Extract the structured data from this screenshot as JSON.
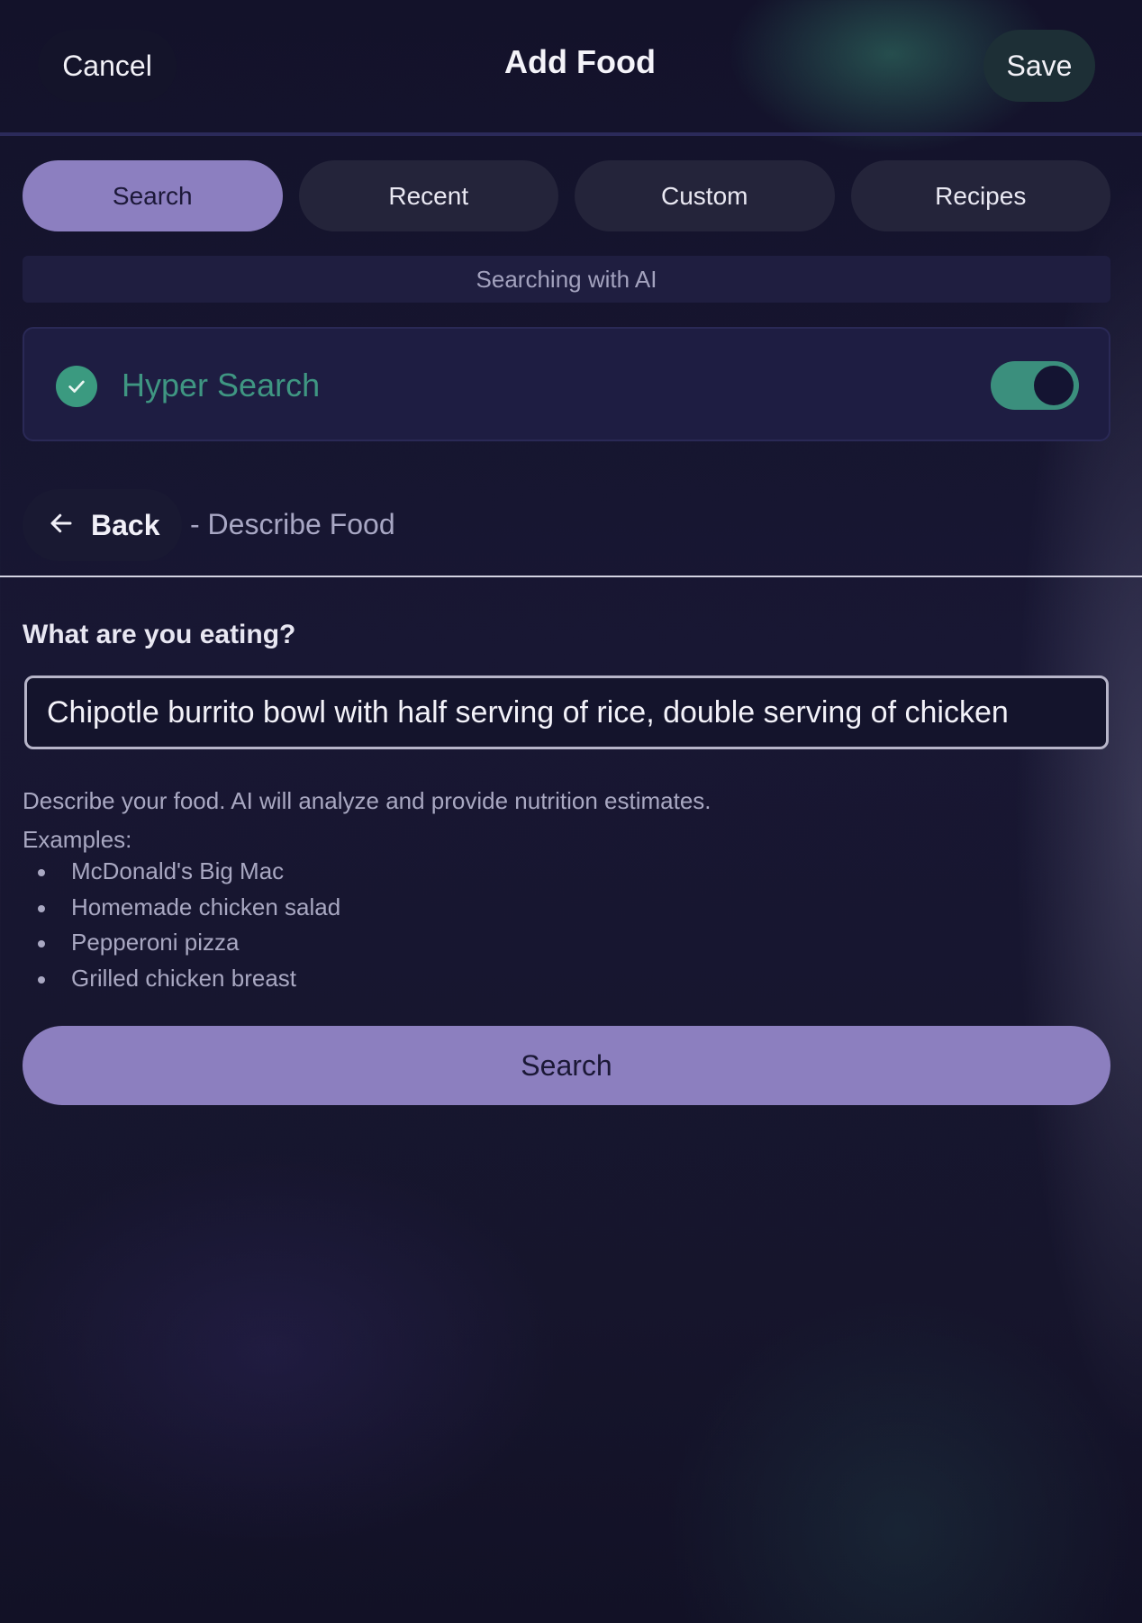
{
  "header": {
    "cancel_label": "Cancel",
    "title": "Add Food",
    "save_label": "Save"
  },
  "tabs": [
    {
      "label": "Search",
      "active": true
    },
    {
      "label": "Recent",
      "active": false
    },
    {
      "label": "Custom",
      "active": false
    },
    {
      "label": "Recipes",
      "active": false
    }
  ],
  "ai_banner": "Searching with AI",
  "hyper_search": {
    "label": "Hyper Search",
    "enabled": true,
    "icon": "check-circle-icon"
  },
  "nav": {
    "back_label": "Back",
    "back_icon": "arrow-left-icon",
    "subtitle": "- Describe Food"
  },
  "form": {
    "question": "What are you eating?",
    "input_value": "Chipotle burrito bowl with half serving of rice, double serving of chicken",
    "helper": "Describe your food. AI will analyze and provide nutrition estimates.",
    "examples_label": "Examples:",
    "examples": [
      "McDonald's Big Mac",
      "Homemade chicken salad",
      "Pepperoni pizza",
      "Grilled chicken breast"
    ],
    "search_label": "Search"
  },
  "colors": {
    "accent": "#8c7fc0",
    "success": "#3b9a80",
    "background": "#16152c"
  }
}
